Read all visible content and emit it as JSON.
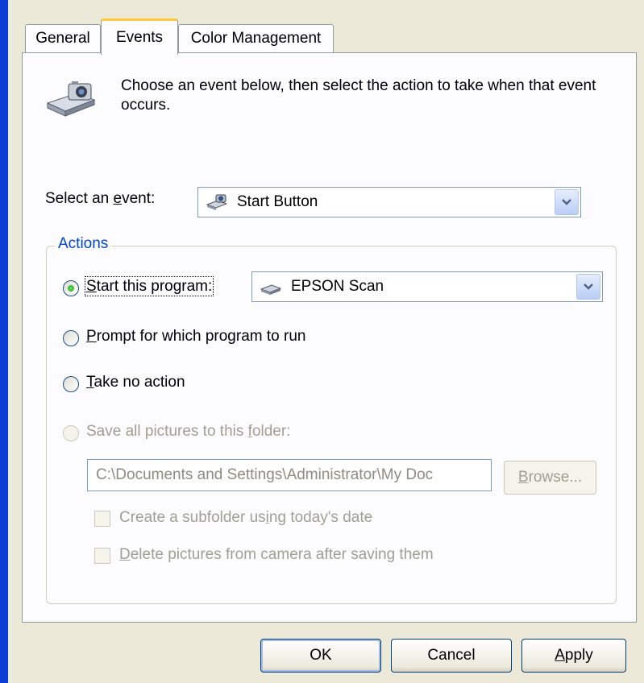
{
  "tabs": [
    {
      "label": "General"
    },
    {
      "label": "Events"
    },
    {
      "label": "Color Management"
    }
  ],
  "active_tab": "Events",
  "intro_text": "Choose an event below, then select the action to take when that event occurs.",
  "event": {
    "label_pre": "Select an ",
    "label_accel": "e",
    "label_post": "vent:",
    "selected": "Start Button"
  },
  "actions": {
    "group_title": "Actions",
    "start_program": {
      "accel": "S",
      "rest": "tart this program:",
      "checked": true
    },
    "program_selected": "EPSON Scan",
    "prompt": {
      "accel": "P",
      "rest": "rompt for which program to run",
      "checked": false
    },
    "no_action": {
      "accel": "T",
      "rest": "ake no action",
      "checked": false
    },
    "save_pictures": {
      "pre": "Save all pictures to this ",
      "accel": "f",
      "post": "older:",
      "enabled": false
    },
    "folder_path": "C:\\Documents and Settings\\Administrator\\My Doc",
    "browse": {
      "accel": "B",
      "rest": "rowse..."
    },
    "subfolder": {
      "pre": "Create a subfolder us",
      "accel": "i",
      "post": "ng today's date",
      "checked": false
    },
    "delete": {
      "accel": "D",
      "rest": "elete pictures from camera after saving them",
      "checked": false
    }
  },
  "buttons": {
    "ok": "OK",
    "cancel": "Cancel",
    "apply_accel": "A",
    "apply_rest": "pply"
  }
}
